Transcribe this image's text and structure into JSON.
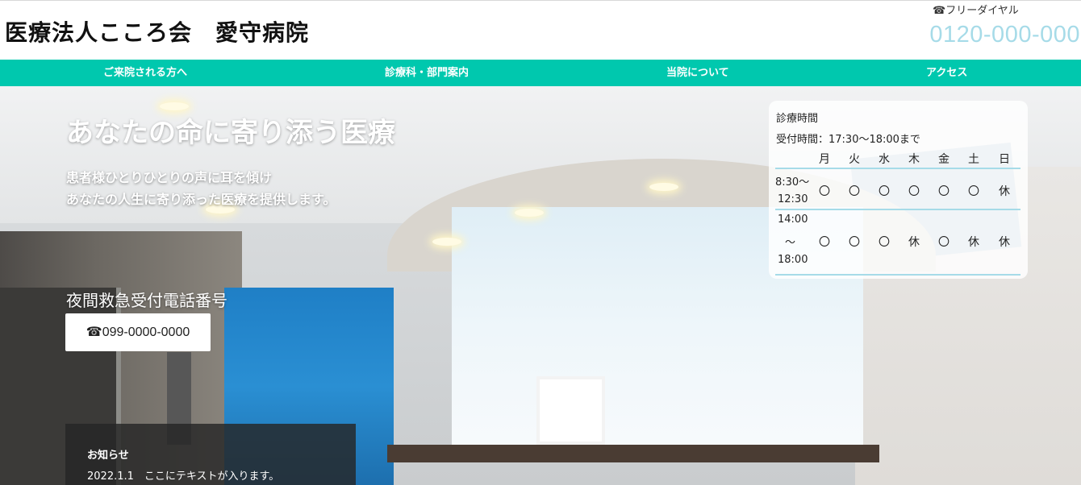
{
  "header": {
    "site_title": "医療法人こころ会　愛守病院",
    "free_dial_label": "☎フリーダイヤル",
    "free_dial_number": "0120-000-000"
  },
  "nav": {
    "items": [
      {
        "label": "ご来院される方へ"
      },
      {
        "label": "診療科・部門案内"
      },
      {
        "label": "当院について"
      },
      {
        "label": "アクセス"
      }
    ]
  },
  "hero": {
    "title": "あなたの命に寄り添う医療",
    "subtitle_line1": "患者様ひとりひとりの声に耳を傾け",
    "subtitle_line2": "あなたの人生に寄り添った医療を提供します。",
    "night_label": "夜間救急受付電話番号",
    "night_phone": "☎099-0000-0000"
  },
  "news": {
    "title": "お知らせ",
    "items": [
      {
        "text": "2022.1.1　ここにテキストが入ります。"
      }
    ]
  },
  "hours": {
    "title": "診療時間",
    "reception": "受付時間：17:30〜18:00まで",
    "days": [
      "月",
      "火",
      "水",
      "木",
      "金",
      "土",
      "日"
    ],
    "slot1": {
      "time_line1": "8:30〜",
      "time_line2": "12:30",
      "marks": [
        "〇",
        "〇",
        "〇",
        "〇",
        "〇",
        "〇",
        "休"
      ]
    },
    "slot2": {
      "time_line1": "14:00",
      "time_line2": "〜",
      "time_line3": "18:00",
      "marks": [
        "〇",
        "〇",
        "〇",
        "休",
        "〇",
        "休",
        "休"
      ]
    }
  },
  "colors": {
    "nav_bg": "#00c8ae",
    "free_number": "#a6dbe8",
    "table_rule": "#a6dbe8"
  }
}
